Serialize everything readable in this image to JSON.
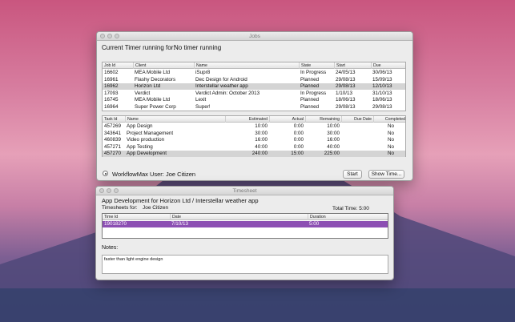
{
  "jobs_window": {
    "title": "Jobs",
    "current_timer_label": "Current Timer running for:",
    "current_timer_value": "No timer running",
    "job_columns": [
      "Job Id",
      "Client",
      "Name",
      "State",
      "Start",
      "Due"
    ],
    "job_rows": [
      {
        "id": "16602",
        "client": "MEA Mobile Ltd",
        "name": "iSupr8",
        "state": "In Progress",
        "start": "24/05/13",
        "due": "30/06/13",
        "selected": false
      },
      {
        "id": "16961",
        "client": "Flashy Decorators",
        "name": "Dec Design for Android",
        "state": "Planned",
        "start": "29/08/13",
        "due": "15/09/13",
        "selected": false
      },
      {
        "id": "16962",
        "client": "Horizon Ltd",
        "name": "Interstellar weather app",
        "state": "Planned",
        "start": "29/08/13",
        "due": "12/10/13",
        "selected": true
      },
      {
        "id": "17093",
        "client": "Verdict",
        "name": "Verdict Admin: October 2013",
        "state": "In Progress",
        "start": "1/10/13",
        "due": "31/10/13",
        "selected": false
      },
      {
        "id": "16745",
        "client": "MEA Mobile Ltd",
        "name": "Lexit",
        "state": "Planned",
        "start": "18/06/13",
        "due": "18/06/13",
        "selected": false
      },
      {
        "id": "16964",
        "client": "Super Power Corp",
        "name": "Super!",
        "state": "Planned",
        "start": "29/08/13",
        "due": "29/08/13",
        "selected": false
      }
    ],
    "task_columns": [
      "Task Id",
      "Name",
      "Estimated",
      "Actual",
      "Remaining",
      "Due Date",
      "Completed"
    ],
    "task_rows": [
      {
        "id": "457269",
        "name": "App Design",
        "estimated": "10:00",
        "actual": "0:00",
        "remaining": "10:00",
        "due": "",
        "completed": "No",
        "selected": false
      },
      {
        "id": "343641",
        "name": "Project Management",
        "estimated": "30:00",
        "actual": "0:00",
        "remaining": "30:00",
        "due": "",
        "completed": "No",
        "selected": false
      },
      {
        "id": "460839",
        "name": "Video production",
        "estimated": "16:00",
        "actual": "0:00",
        "remaining": "16:00",
        "due": "",
        "completed": "No",
        "selected": false
      },
      {
        "id": "457271",
        "name": "App Testing",
        "estimated": "40:00",
        "actual": "0:00",
        "remaining": "40:00",
        "due": "",
        "completed": "No",
        "selected": false
      },
      {
        "id": "457270",
        "name": "App Development",
        "estimated": "240:00",
        "actual": "15:00",
        "remaining": "225:00",
        "due": "",
        "completed": "No",
        "selected": true
      }
    ],
    "user_label": "WorkflowMax User: Joe Citizen",
    "start_button": "Start",
    "show_time_button": "Show Time..."
  },
  "timesheet_window": {
    "title": "Timesheet",
    "heading": "App Development for Horizon Ltd / Interstellar weather app",
    "timesheets_for_label": "Timesheets for:",
    "timesheets_for_value": "Joe Citizen",
    "total_time": "Total Time: 5:00",
    "columns": [
      "Time Id",
      "Date",
      "Duration"
    ],
    "rows": [
      {
        "id": "19018270",
        "date": "7/10/13",
        "duration": "5:00",
        "selected": true
      }
    ],
    "notes_label": "Notes:",
    "notes_value": "faster than light engine design"
  },
  "colors": {
    "selection_purple": "#8c4fb3",
    "selection_gray": "#d4d4d4"
  }
}
